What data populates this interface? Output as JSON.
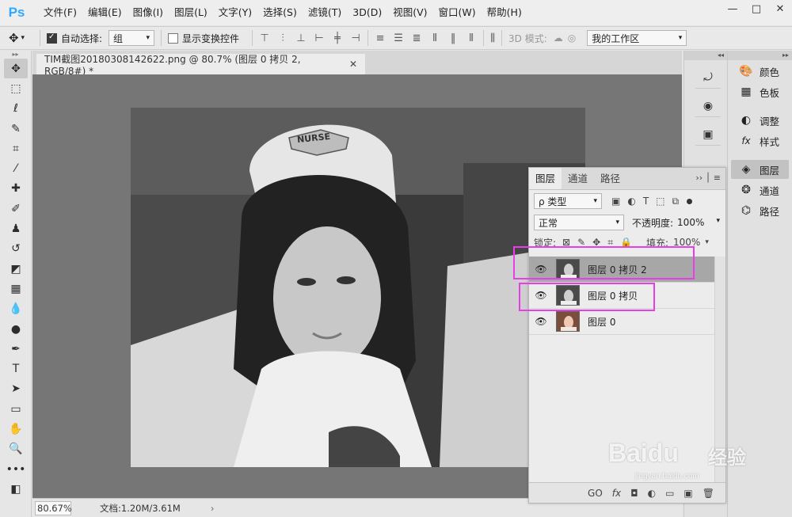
{
  "app": {
    "logo": "Ps",
    "menu": [
      "文件(F)",
      "编辑(E)",
      "图像(I)",
      "图层(L)",
      "文字(Y)",
      "选择(S)",
      "滤镜(T)",
      "3D(D)",
      "视图(V)",
      "窗口(W)",
      "帮助(H)"
    ],
    "window_buttons": [
      "—",
      "□",
      "✕"
    ]
  },
  "options": {
    "auto_select_label": "自动选择:",
    "auto_select_value": "组",
    "transform_label": "显示变换控件",
    "mode_3d_label": "3D 模式:",
    "workspace": "我的工作区"
  },
  "document": {
    "tab_title": "TIM截图20180308142622.png @ 80.7% (图层 0 拷贝 2, RGB/8#) *",
    "zoom": "80.67%",
    "doc_info": "文档:1.20M/3.61M",
    "image_overlay_text": "NURSE"
  },
  "right_panels": {
    "items": [
      {
        "label": "颜色",
        "icon": "color-wheel-icon"
      },
      {
        "label": "色板",
        "icon": "swatches-icon"
      },
      {
        "label": "调整",
        "icon": "adjustments-icon"
      },
      {
        "label": "样式",
        "icon": "styles-icon"
      },
      {
        "label": "图层",
        "icon": "layers-icon"
      },
      {
        "label": "通道",
        "icon": "channels-icon"
      },
      {
        "label": "路径",
        "icon": "paths-icon"
      }
    ]
  },
  "layers_panel": {
    "tabs": [
      "图层",
      "通道",
      "路径"
    ],
    "filter_label": "ρ 类型",
    "blend_mode": "正常",
    "opacity_label": "不透明度:",
    "opacity_value": "100%",
    "lock_label": "锁定:",
    "fill_label": "填充:",
    "fill_value": "100%",
    "layers": [
      {
        "name": "图层 0 拷贝 2",
        "selected": true,
        "grayscale": true
      },
      {
        "name": "图层 0 拷贝",
        "selected": false,
        "grayscale": true
      },
      {
        "name": "图层 0",
        "selected": false,
        "grayscale": false
      }
    ],
    "bottom_icons": [
      "GO",
      "fx",
      "◘",
      "◐",
      "▭",
      "▣",
      "🗑"
    ]
  },
  "watermark": {
    "brand": "Baidu",
    "subtitle": "经验",
    "url": "jingyan.baidu.com"
  },
  "colors": {
    "highlight": "#e83ee8",
    "canvas_bg": "#767676"
  }
}
